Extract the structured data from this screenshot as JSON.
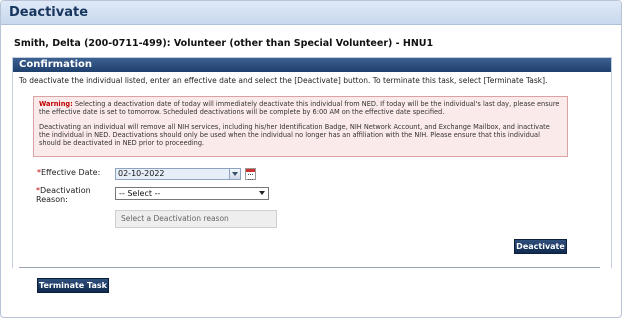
{
  "window": {
    "title": "Deactivate"
  },
  "person": {
    "heading": "Smith, Delta (200-0711-499): Volunteer (other than Special Volunteer) - HNU1"
  },
  "confirmation": {
    "header": "Confirmation",
    "instructions": "To deactivate the individual listed, enter an effective date and select the [Deactivate] button. To terminate this task, select [Terminate Task].",
    "warning_label": "Warning:",
    "warning_text": "Selecting a deactivation date of today will immediately deactivate this individual from NED. If today will be the individual's last day, please ensure the effective date is set to tomorrow. Scheduled deactivations will be complete by 6:00 AM on the effective date specified.",
    "warning_text2": "Deactivating an individual will remove all NIH services, including his/her Identification Badge, NIH Network Account, and Exchange Mailbox, and inactivate the individual in NED. Deactivations should only be used when the individual no longer has an affiliation with the NIH. Please ensure that this individual should be deactivated in NED prior to proceeding."
  },
  "form": {
    "required_mark": "*",
    "effective_date_label": "Effective Date:",
    "effective_date_value": "02-10-2022",
    "reason_label": "Deactivation Reason:",
    "reason_selected": "-- Select --",
    "reason_placeholder": "Select a Deactivation reason"
  },
  "buttons": {
    "deactivate": "Deactivate",
    "terminate": "Terminate Task"
  },
  "icons": {
    "date_dropdown": "chevron-down-icon",
    "calendar": "calendar-icon",
    "select_chevron": "chevron-down-icon"
  },
  "colors": {
    "header_navy": "#1f3f6c",
    "warning_red": "#c00000",
    "warning_bg": "#fbeaea",
    "title_text": "#17365d"
  }
}
